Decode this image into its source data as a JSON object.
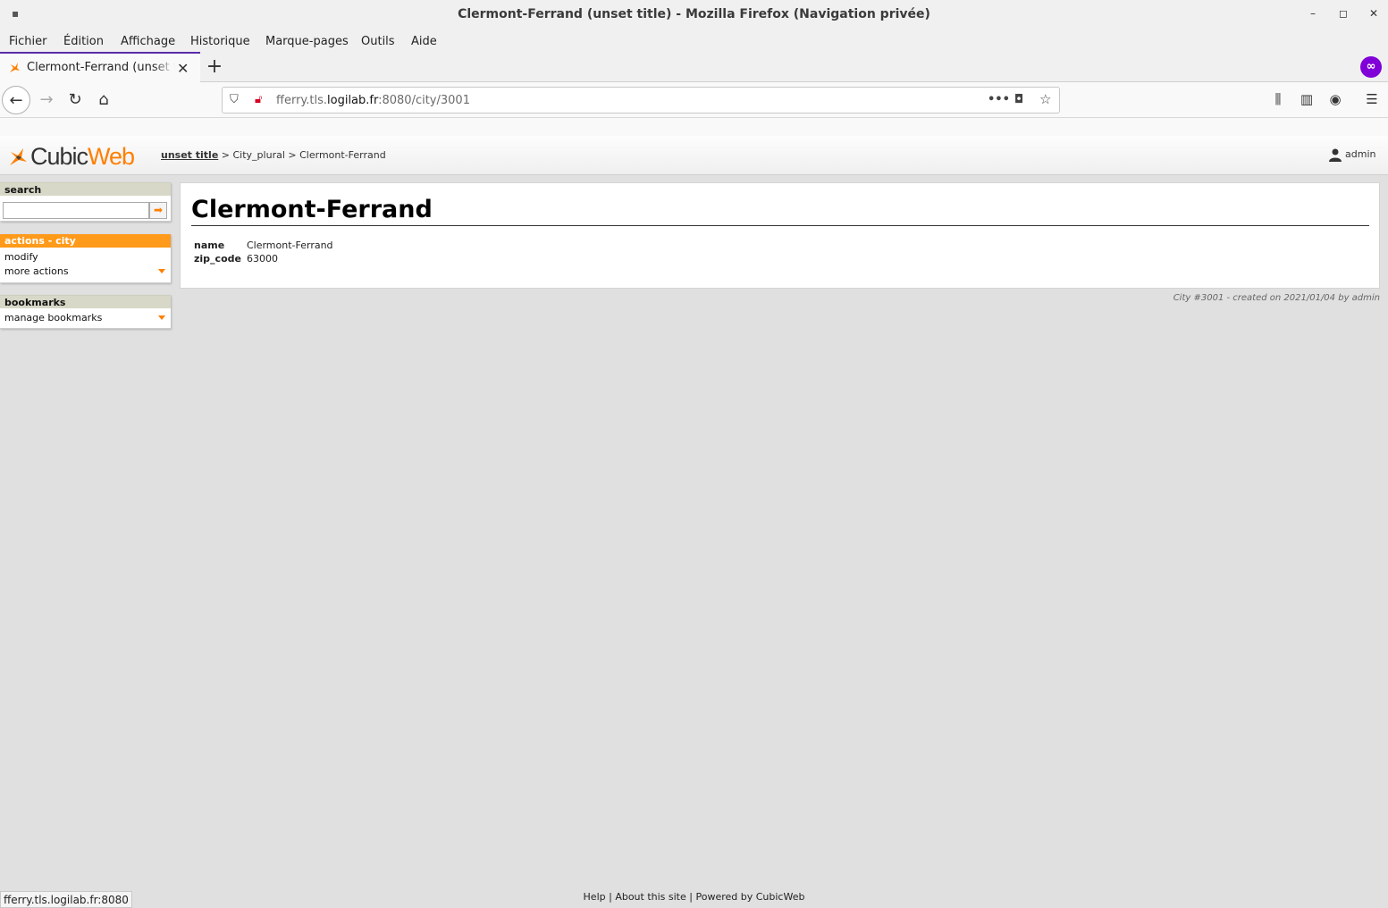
{
  "window": {
    "title": "Clermont-Ferrand (unset title) - Mozilla Firefox (Navigation privée)",
    "controls": {
      "minimize": "–",
      "maximize": "◻",
      "close": "✕"
    }
  },
  "menubar": {
    "items": [
      "Fichier",
      "Édition",
      "Affichage",
      "Historique",
      "Marque-pages",
      "Outils",
      "Aide"
    ]
  },
  "tab": {
    "title": "Clermont-Ferrand (unset title)",
    "new_tab": "+"
  },
  "urlbar": {
    "url_prefix": "fferry.tls.",
    "url_domain": "logilab.fr",
    "url_suffix": ":8080/city/3001"
  },
  "cw": {
    "logo": {
      "part1": "Cubic",
      "part2": "Web"
    },
    "breadcrumb": {
      "root": "unset title",
      "sep1": " > ",
      "plural": "City_plural",
      "sep2": " > ",
      "current": "Clermont-Ferrand"
    },
    "user": "admin"
  },
  "sidebar": {
    "search": {
      "title": "search",
      "go_label": "➡"
    },
    "actions": {
      "title": "actions - city",
      "items": [
        "modify",
        "more actions"
      ]
    },
    "bookmarks": {
      "title": "bookmarks",
      "items": [
        "manage bookmarks"
      ]
    }
  },
  "entity": {
    "title": "Clermont-Ferrand",
    "attributes": [
      {
        "label": "name",
        "value": "Clermont-Ferrand"
      },
      {
        "label": "zip_code",
        "value": "63000"
      }
    ],
    "meta": "City #3001 - created on 2021/01/04 by admin"
  },
  "footer": {
    "links": [
      "Help",
      "About this site",
      "Powered by CubicWeb"
    ],
    "separator": " | "
  },
  "statusbar": {
    "text": "fferry.tls.logilab.fr:8080"
  },
  "colors": {
    "accent": "#ff7f00",
    "private": "#8000d7",
    "page_bg": "#e0e0e0"
  }
}
